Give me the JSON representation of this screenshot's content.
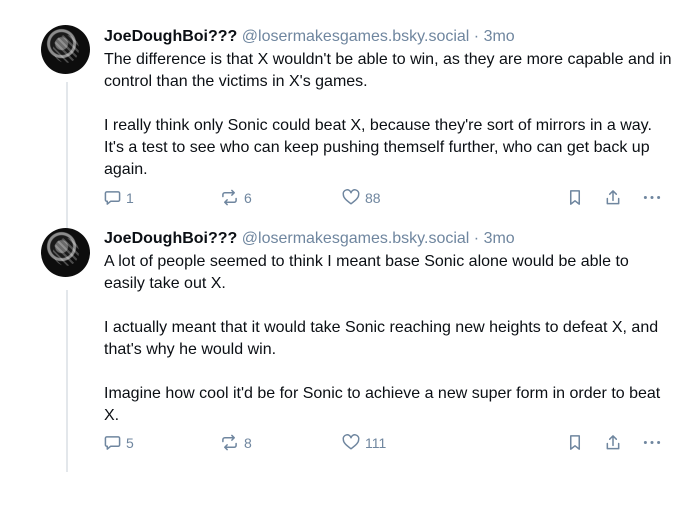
{
  "posts": [
    {
      "author": "JoeDoughBoi???",
      "handle": "@losermakesgames.bsky.social",
      "separator": "·",
      "time": "3mo",
      "paragraphs": [
        "The difference is that X wouldn't be able to win, as they are more capable and in control than the victims in X's games.",
        "I really think only Sonic could beat X, because they're sort of mirrors in a way. It's a test to see who can keep pushing themself further, who can get back up again."
      ],
      "replies": "1",
      "reposts": "6",
      "likes": "88"
    },
    {
      "author": "JoeDoughBoi???",
      "handle": "@losermakesgames.bsky.social",
      "separator": "·",
      "time": "3mo",
      "paragraphs": [
        "A lot of people seemed to think I meant base Sonic alone would be able to easily take out X.",
        "I actually meant that it would take Sonic reaching new heights to defeat X, and that's why he would win.",
        "Imagine how cool it'd be for Sonic to achieve a new super form in order to beat X."
      ],
      "replies": "5",
      "reposts": "8",
      "likes": "111"
    }
  ],
  "icons": {
    "reply": "speech-bubble-icon",
    "repost": "repost-arrows-icon",
    "like": "heart-icon",
    "bookmark": "bookmark-icon",
    "share": "share-icon",
    "more": "more-dots-icon"
  },
  "colors": {
    "text": "#0b0f14",
    "muted": "#6f869f",
    "thread": "#e3e7eb"
  }
}
